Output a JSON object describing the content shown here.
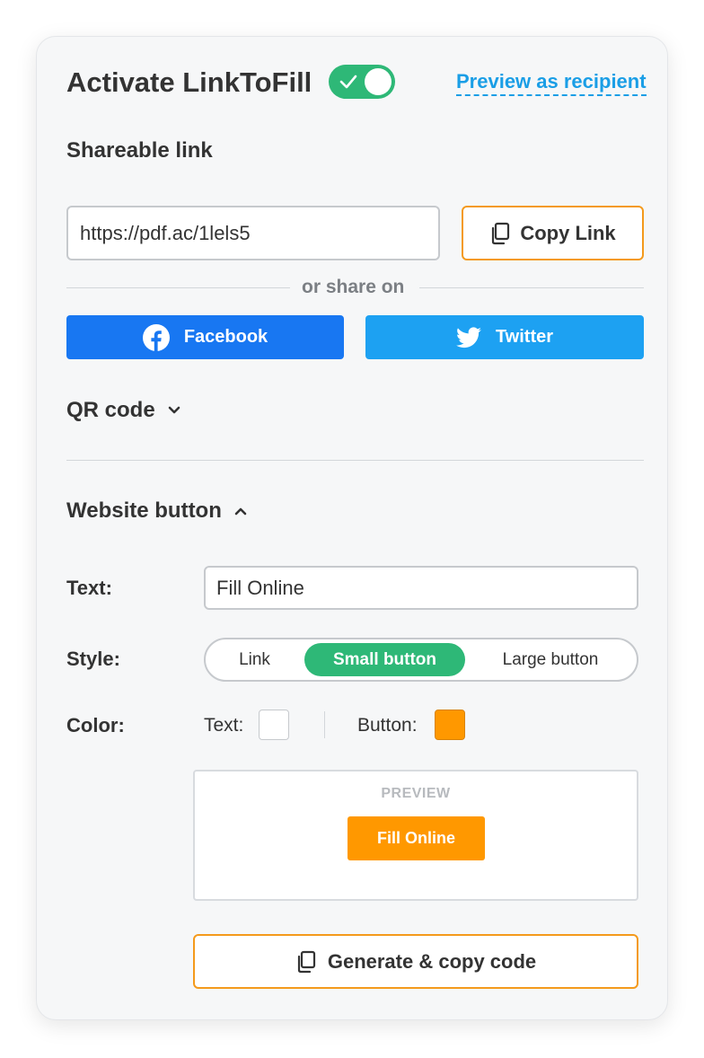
{
  "header": {
    "title": "Activate LinkToFill",
    "toggle_on": true,
    "preview_link": "Preview as recipient"
  },
  "shareable": {
    "heading": "Shareable link",
    "url": "https://pdf.ac/1lels5",
    "copy_label": "Copy Link",
    "or_share_on": "or share on",
    "facebook_label": "Facebook",
    "twitter_label": "Twitter"
  },
  "qr": {
    "label": "QR code",
    "icon": "chevron-down-icon"
  },
  "website_button": {
    "label": "Website button",
    "icon": "chevron-up-icon",
    "text_label": "Text:",
    "text_value": "Fill Online",
    "style_label": "Style:",
    "style_options": [
      "Link",
      "Small button",
      "Large button"
    ],
    "style_selected": "Small button",
    "color_label": "Color:",
    "text_color_label": "Text:",
    "text_color": "#ffffff",
    "button_color_label": "Button:",
    "button_color": "#ff9800",
    "preview_title": "PREVIEW",
    "preview_button_text": "Fill Online",
    "generate_label": "Generate & copy code"
  },
  "colors": {
    "accent_green": "#2eb877",
    "accent_orange": "#f49a1c",
    "link_blue": "#1a9ee6",
    "facebook_blue": "#1877f2",
    "twitter_blue": "#1da1f2"
  }
}
